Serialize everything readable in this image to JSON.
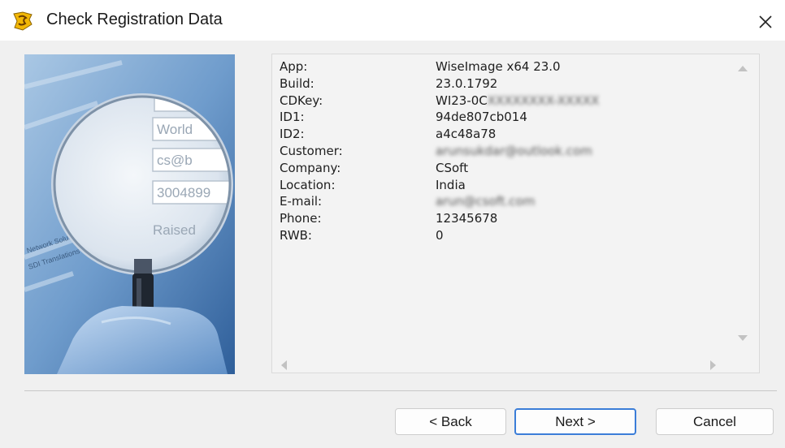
{
  "window": {
    "title": "Check Registration Data",
    "app_icon": "wiseimage-logo-icon",
    "close_icon": "close-icon"
  },
  "image_panel": {
    "illustration": "magnifying-glass-over-form-illustration",
    "form_fields": [
      "World",
      "cs@b",
      "3004899",
      "Raised"
    ]
  },
  "registration": {
    "rows": [
      {
        "label": "App:",
        "value": "WiseImage x64 23.0",
        "blurred": false
      },
      {
        "label": "Build:",
        "value": "23.0.1792",
        "blurred": false
      },
      {
        "label": "CDKey:",
        "value": "WI23-0C",
        "blurred_suffix": "XXXXXXXX-XXXXX"
      },
      {
        "label": "ID1:",
        "value": "94de807cb014",
        "blurred": false
      },
      {
        "label": "ID2:",
        "value": "a4c48a78",
        "blurred": false
      },
      {
        "label": "Customer:",
        "value": "arunsukdar@outlook.com",
        "blurred": true
      },
      {
        "label": "Company:",
        "value": "CSoft",
        "blurred": false
      },
      {
        "label": "Location:",
        "value": "India",
        "blurred": false
      },
      {
        "label": "E-mail:",
        "value": "arun@csoft.com",
        "blurred": true
      },
      {
        "label": "Phone:",
        "value": "12345678",
        "blurred": false
      },
      {
        "label": "RWB:",
        "value": "0",
        "blurred": false
      }
    ]
  },
  "buttons": {
    "back": "< Back",
    "next": "Next >",
    "cancel": "Cancel"
  },
  "colors": {
    "accent": "#3b7dd8",
    "window_bg": "#f0f0f0",
    "titlebar_bg": "#ffffff"
  }
}
